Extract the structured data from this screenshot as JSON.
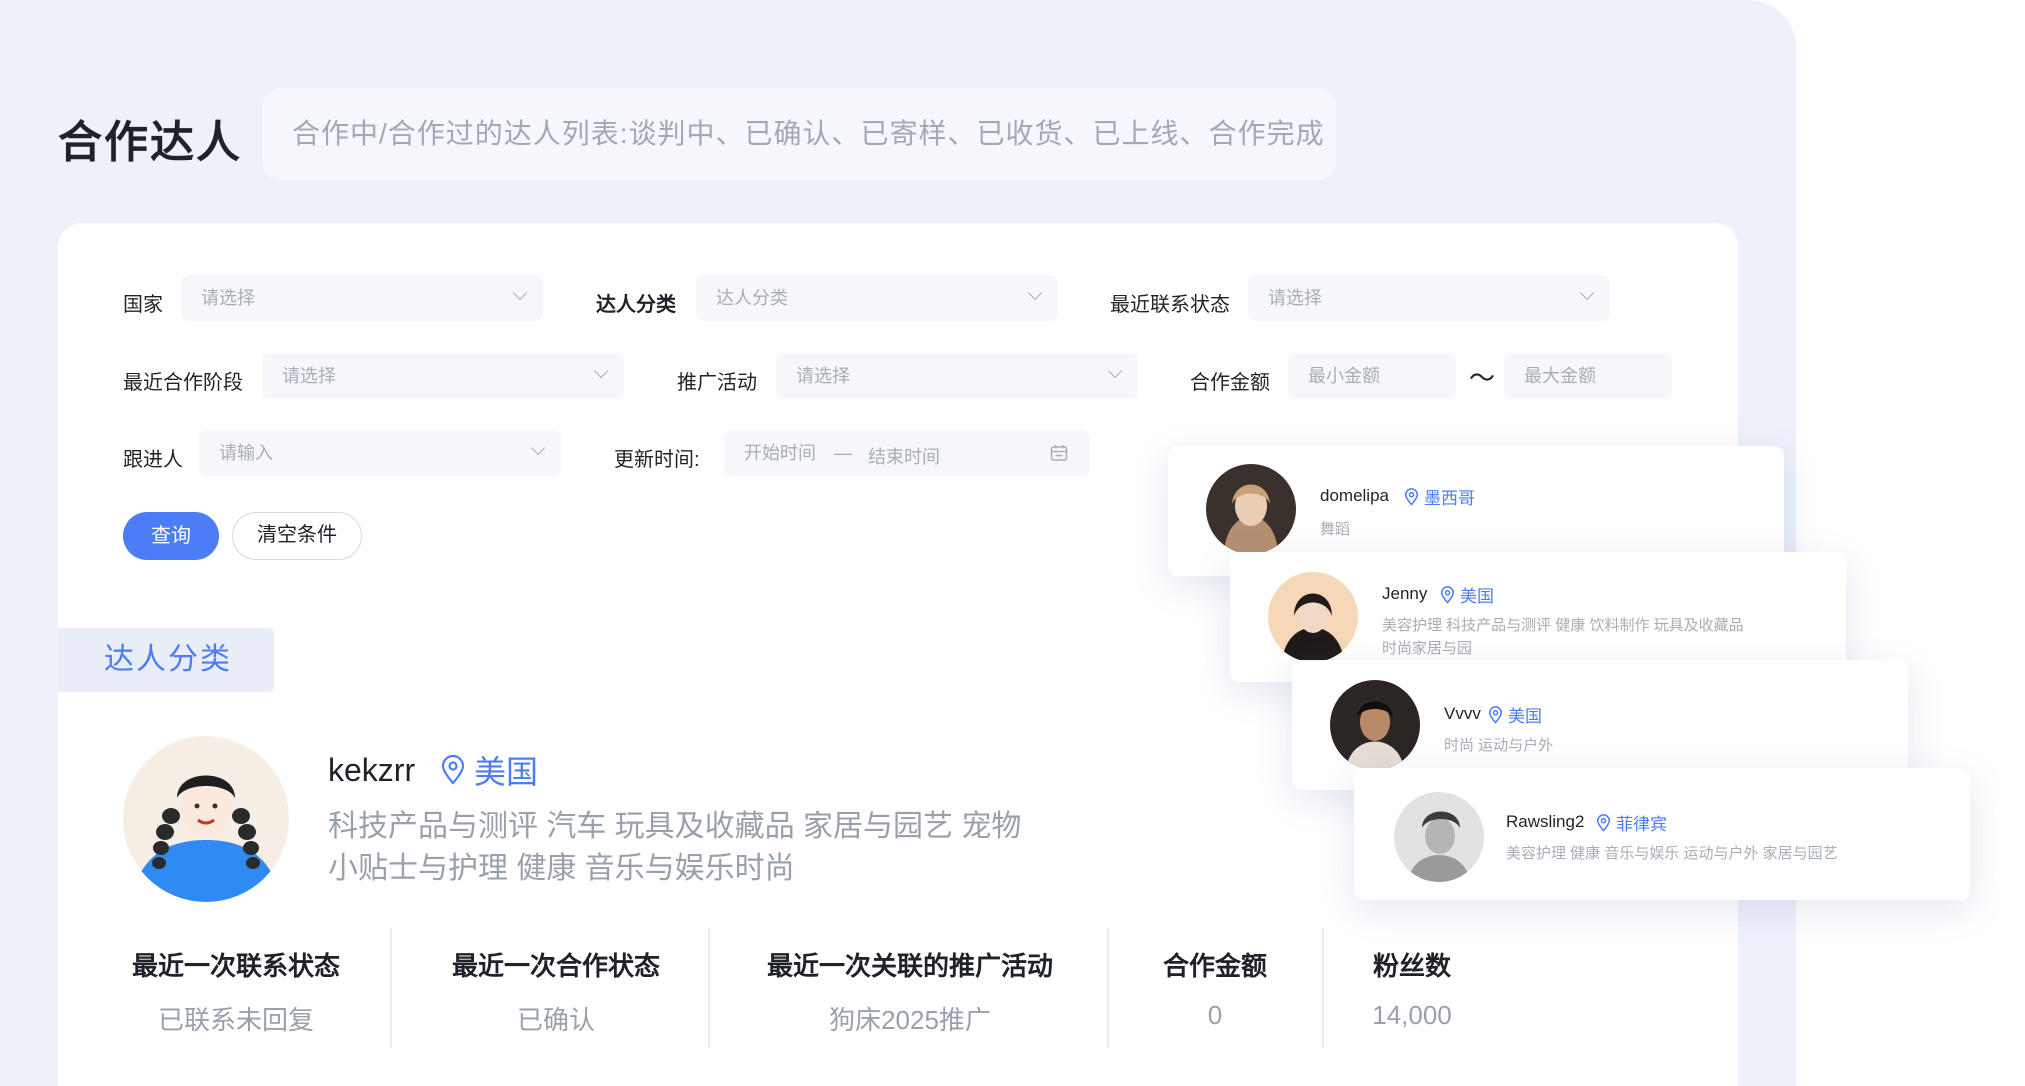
{
  "header": {
    "title": "合作达人",
    "description": "合作中/合作过的达人列表:谈判中、已确认、已寄样、已收货、已上线、合作完成"
  },
  "filters": {
    "country": {
      "label": "国家",
      "placeholder": "请选择"
    },
    "category": {
      "label": "达人分类",
      "placeholder": "达人分类"
    },
    "contact_status": {
      "label": "最近联系状态",
      "placeholder": "请选择"
    },
    "coop_stage": {
      "label": "最近合作阶段",
      "placeholder": "请选择"
    },
    "campaign": {
      "label": "推广活动",
      "placeholder": "请选择"
    },
    "amount": {
      "label": "合作金额",
      "min_placeholder": "最小金额",
      "separator": "～",
      "max_placeholder": "最大金额"
    },
    "follower": {
      "label": "跟进人",
      "placeholder": "请输入"
    },
    "update_time": {
      "label": "更新时间:",
      "start_placeholder": "开始时间",
      "separator": "—",
      "end_placeholder": "结束时间"
    }
  },
  "buttons": {
    "query": "查询",
    "clear": "清空条件"
  },
  "section_tab": "达人分类",
  "influencer": {
    "name": "kekzrr",
    "location": "美国",
    "categories": "科技产品与测评 汽车 玩具及收藏品 家居与园艺 宠物小贴士与护理 健康 音乐与娱乐时尚"
  },
  "stats": [
    {
      "label": "最近一次联系状态",
      "value": "已联系未回复"
    },
    {
      "label": "最近一次合作状态",
      "value": "已确认"
    },
    {
      "label": "最近一次关联的推广活动",
      "value": "狗床2025推广"
    },
    {
      "label": "合作金额",
      "value": "0"
    },
    {
      "label": "粉丝数",
      "value": "14,000"
    }
  ],
  "cards": [
    {
      "name": "domelipa",
      "location": "墨西哥",
      "categories": "舞蹈"
    },
    {
      "name": "Jenny",
      "location": "美国",
      "categories_line1": "美容护理 科技产品与测评 健康 饮料制作 玩具及收藏品",
      "categories_line2": "时尚家居与园"
    },
    {
      "name": "Vvvv",
      "location": "美国",
      "categories": "时尚 运动与户外"
    },
    {
      "name": "Rawsling2",
      "location": "菲律宾",
      "categories": "美容护理 健康 音乐与娱乐 运动与户外 家居与园艺"
    }
  ],
  "colors": {
    "accent": "#4c7cf6",
    "background": "#eef1fa",
    "muted": "#9aa0ab"
  },
  "icons": [
    "chevron-down-icon",
    "calendar-icon",
    "location-pin-icon",
    "avatar"
  ]
}
